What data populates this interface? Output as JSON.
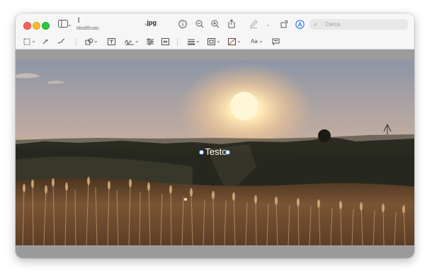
{
  "window": {
    "filename": "l",
    "extension": ".jpg",
    "status": "Modificato"
  },
  "search": {
    "placeholder": "Cerca"
  },
  "annotation": {
    "text": "Testo"
  },
  "markup_toolbar": {
    "font_label": "Aa"
  },
  "colors": {
    "accent": "#2d7bf5",
    "close": "#fe5f57",
    "minimize": "#febc2e",
    "maximize": "#28c840"
  },
  "icons": [
    "sidebar-icon",
    "info-icon",
    "zoom-out-icon",
    "zoom-in-icon",
    "share-icon",
    "highlight-icon",
    "rotate-icon",
    "markup-icon",
    "search-icon",
    "selection-icon",
    "instant-alpha-icon",
    "sketch-icon",
    "shapes-icon",
    "text-box-icon",
    "sign-icon",
    "adjust-color-icon",
    "adjust-size-icon",
    "line-style-icon",
    "border-color-icon",
    "fill-color-icon",
    "text-style-icon",
    "description-icon"
  ]
}
